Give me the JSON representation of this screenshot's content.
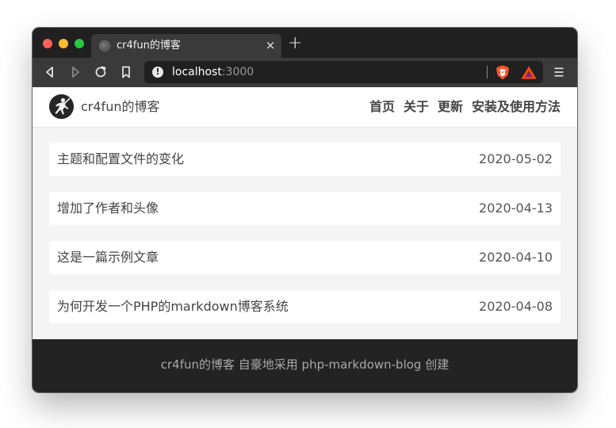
{
  "browser": {
    "tab": {
      "title": "cr4fun的博客",
      "close_glyph": "×"
    },
    "new_tab_glyph": "+",
    "address": {
      "host": "localhost",
      "port": ":3000"
    },
    "menu_glyph": "☰",
    "icons": [
      "back-icon",
      "forward-icon",
      "reload-icon",
      "bookmark-icon",
      "info-icon",
      "brave-shields-icon",
      "brave-rewards-icon",
      "menu-icon"
    ]
  },
  "site": {
    "title": "cr4fun的博客",
    "nav": [
      {
        "label": "首页"
      },
      {
        "label": "关于"
      },
      {
        "label": "更新"
      },
      {
        "label": "安装及使用方法"
      }
    ]
  },
  "posts": [
    {
      "title": "主题和配置文件的变化",
      "date": "2020-05-02"
    },
    {
      "title": "增加了作者和头像",
      "date": "2020-04-13"
    },
    {
      "title": "这是一篇示例文章",
      "date": "2020-04-10"
    },
    {
      "title": "为何开发一个PHP的markdown博客系统",
      "date": "2020-04-08"
    }
  ],
  "footer": {
    "text": "cr4fun的博客 自豪地采用 php-markdown-blog 创建"
  },
  "colors": {
    "tab_strip": "#202020",
    "toolbar": "#3a3a3a",
    "page_bg": "#f4f4f4",
    "footer_bg": "#232323",
    "text": "#444444"
  }
}
